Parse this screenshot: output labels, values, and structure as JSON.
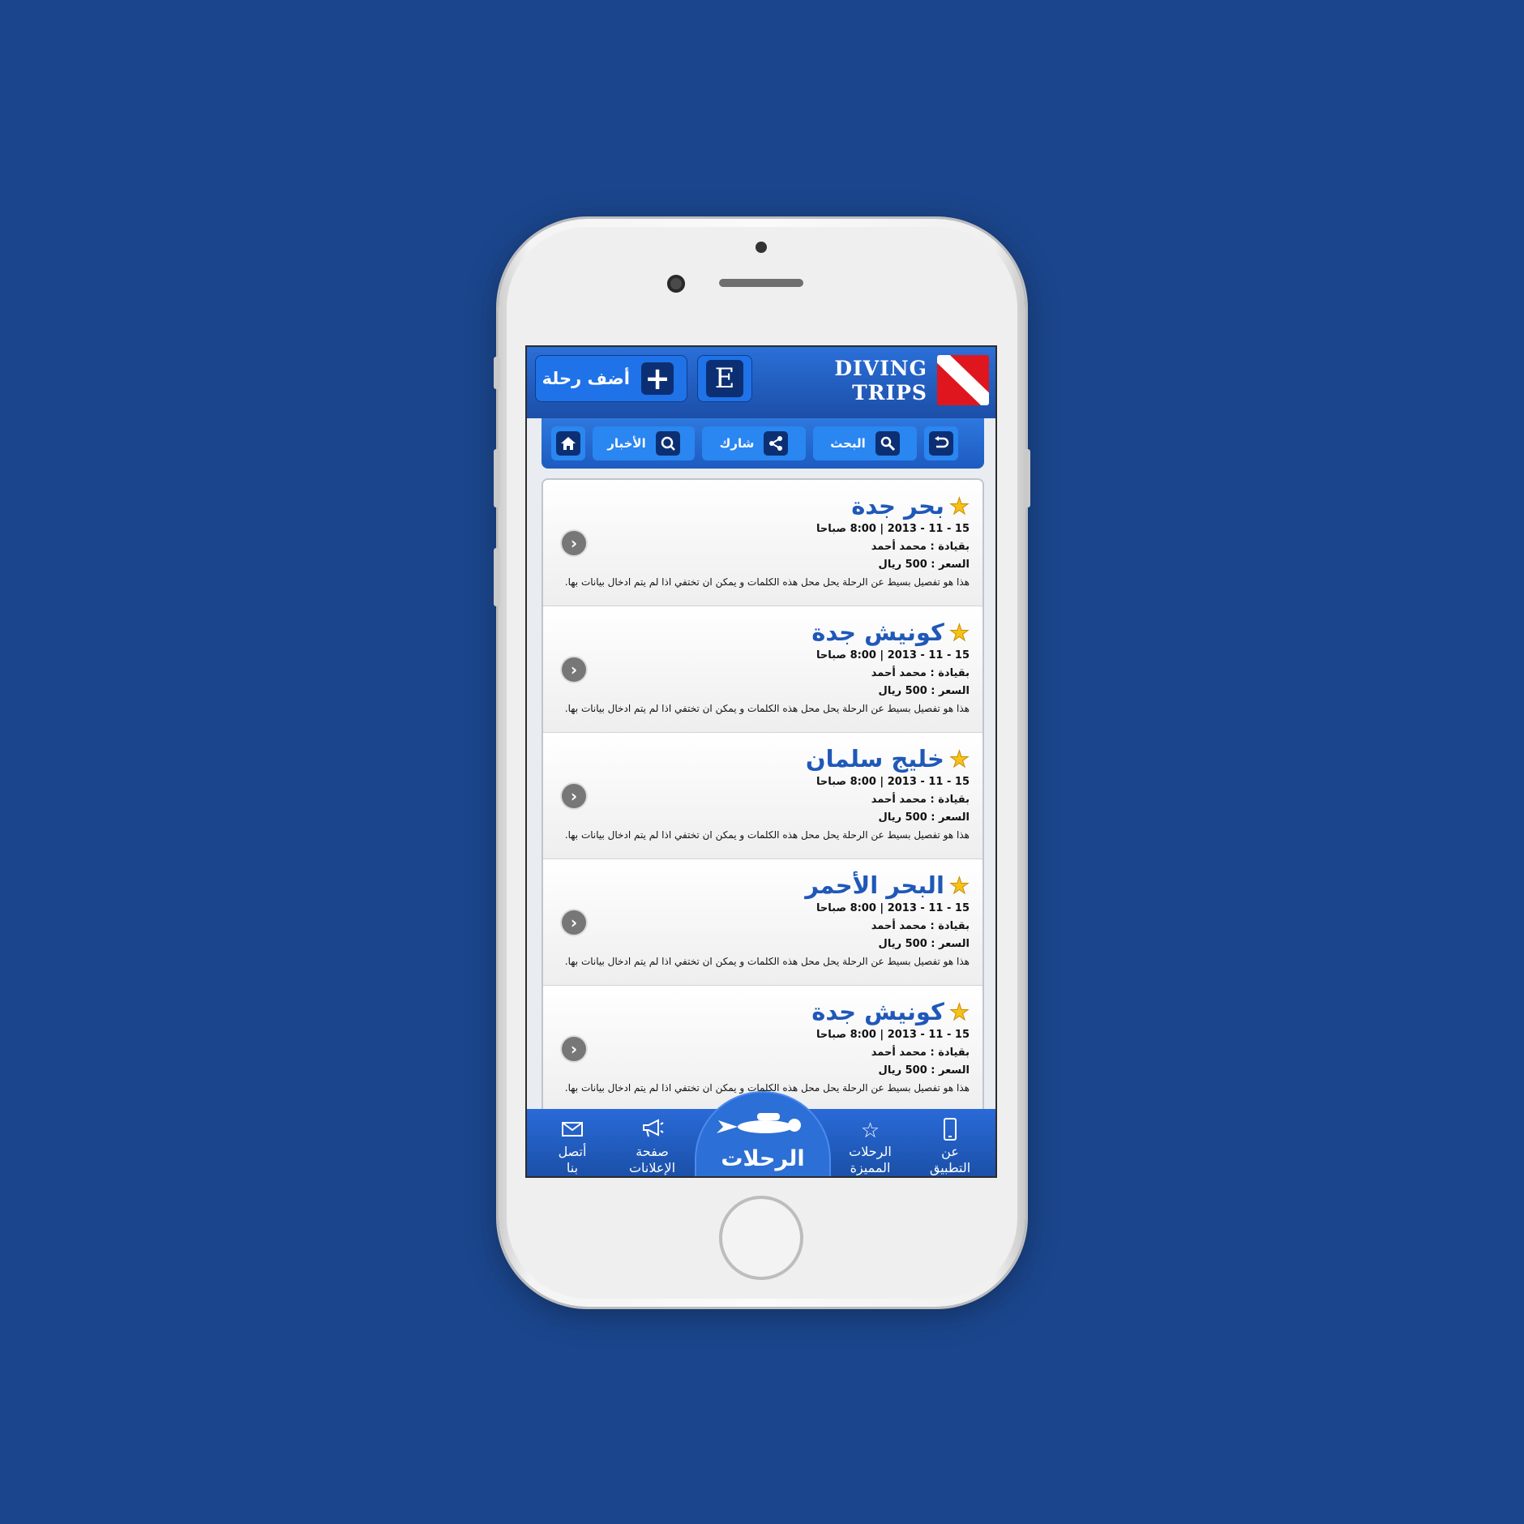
{
  "header": {
    "add_trip_label": "أضف رحلة",
    "add_icon": "plus-icon",
    "lang_label": "E",
    "logo_line1": "DIVING",
    "logo_line2": "TRIPS"
  },
  "toolbar": {
    "back_icon": "back-icon",
    "search_label": "البحث",
    "share_label": "شارك",
    "news_label": "الأخبار",
    "home_icon": "home-icon"
  },
  "trips": [
    {
      "title": "بحر جدة",
      "datetime": "15 - 11 - 2013  |  8:00 صباحا",
      "leader": "بقيادة : محمد أحمد",
      "price": "السعر : 500 ريال",
      "desc": "هذا هو تفصيل بسيط عن الرحلة يحل محل هذه الكلمات و يمكن ان تختفي اذا لم يتم ادخال بيانات بها."
    },
    {
      "title": "كونيش جدة",
      "datetime": "15 - 11 - 2013  |  8:00 صباحا",
      "leader": "بقيادة : محمد أحمد",
      "price": "السعر : 500 ريال",
      "desc": "هذا هو تفصيل بسيط عن الرحلة يحل محل هذه الكلمات و يمكن ان تختفي اذا لم يتم ادخال بيانات بها."
    },
    {
      "title": "خليج سلمان",
      "datetime": "15 - 11 - 2013  |  8:00 صباحا",
      "leader": "بقيادة : محمد أحمد",
      "price": "السعر : 500 ريال",
      "desc": "هذا هو تفصيل بسيط عن الرحلة يحل محل هذه الكلمات و يمكن ان تختفي اذا لم يتم ادخال بيانات بها."
    },
    {
      "title": "البحر الأحمر",
      "datetime": "15 - 11 - 2013  |  8:00 صباحا",
      "leader": "بقيادة : محمد أحمد",
      "price": "السعر : 500 ريال",
      "desc": "هذا هو تفصيل بسيط عن الرحلة يحل محل هذه الكلمات و يمكن ان تختفي اذا لم يتم ادخال بيانات بها."
    },
    {
      "title": "كونيش جدة",
      "datetime": "15 - 11 - 2013  |  8:00 صباحا",
      "leader": "بقيادة : محمد أحمد",
      "price": "السعر : 500 ريال",
      "desc": "هذا هو تفصيل بسيط عن الرحلة يحل محل هذه الكلمات و يمكن ان تختفي اذا لم يتم ادخال بيانات بها."
    }
  ],
  "bottom_nav": {
    "about_line1": "عن",
    "about_line2": "التطبيق",
    "featured_line1": "الرحلات",
    "featured_line2": "المميزة",
    "trips_label": "الرحلات",
    "ads_line1": "صفحة",
    "ads_line2": "الإعلانات",
    "contact_line1": "أتصل",
    "contact_line2": "بنا"
  },
  "colors": {
    "background": "#1b468d",
    "accent_blue": "#1f72e8",
    "title_blue": "#1f58b8",
    "star": "#f6c218",
    "flag_red": "#e0161e"
  }
}
